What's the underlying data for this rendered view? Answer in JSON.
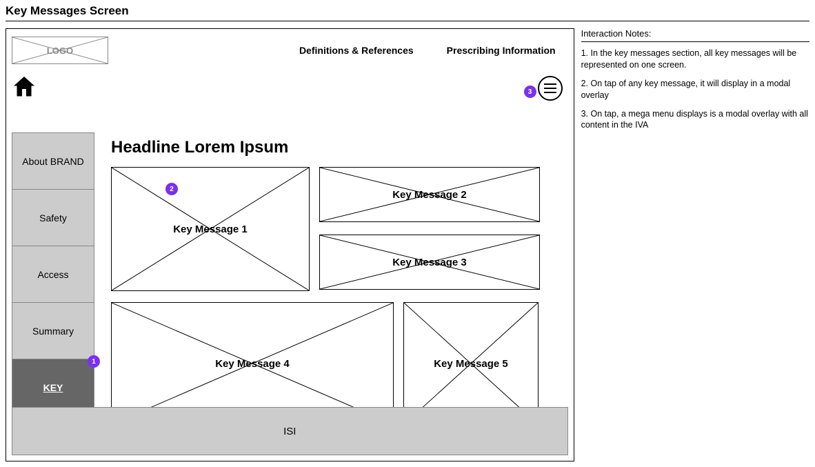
{
  "page_title": "Key Messages Screen",
  "header": {
    "logo_label": "LOGO",
    "links": {
      "definitions": "Definitions & References",
      "prescribing": "Prescribing Information"
    }
  },
  "sidebar": {
    "items": [
      {
        "label": "About BRAND"
      },
      {
        "label": "Safety"
      },
      {
        "label": "Access"
      },
      {
        "label": "Summary"
      },
      {
        "label": "KEY"
      }
    ]
  },
  "main": {
    "headline": "Headline Lorem Ipsum",
    "tiles": {
      "km1": "Key Message 1",
      "km2": "Key Message 2",
      "km3": "Key Message 3",
      "km4": "Key Message 4",
      "km5": "Key Message 5"
    }
  },
  "footer": {
    "isi": "ISI"
  },
  "annotations": {
    "b1": "1",
    "b2": "2",
    "b3": "3"
  },
  "notes": {
    "heading": "Interaction Notes:",
    "items": [
      "1. In the key messages section, all key messages will be represented on one screen.",
      "2. On tap of any key message, it will display in a modal overlay",
      "3. On tap, a mega menu displays is a modal overlay with all content in the IVA"
    ]
  }
}
